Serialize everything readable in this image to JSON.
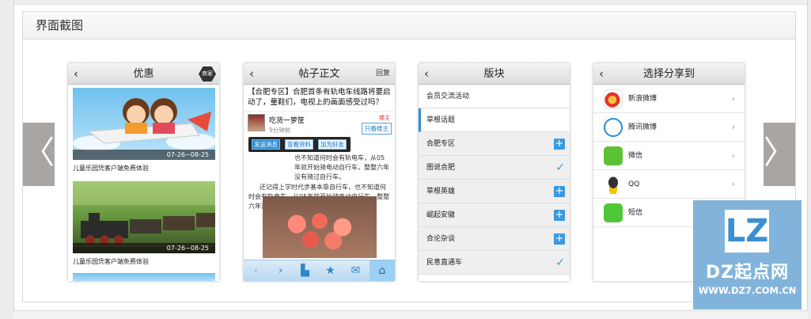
{
  "section": {
    "title": "界面截图"
  },
  "nav": {
    "prev": "〈",
    "next": "〉"
  },
  "phone1": {
    "title": "优惠",
    "badge": "商家",
    "items": [
      {
        "date": "07-26~08-25",
        "caption": "儿童乐园凭客户端免费体验"
      },
      {
        "date": "07-26~08-25",
        "caption": "儿童乐园凭客户端免费体验"
      }
    ]
  },
  "phone2": {
    "title": "帖子正文",
    "reply": "回复",
    "post_title": "【合肥专区】合肥首条有轨电车线路将要启动了，童鞋们，电视上的画面感受过吗？",
    "author": "吃货一箩筐",
    "time": "9分钟前",
    "floor": "楼主",
    "only_host": "只看楼主",
    "body": [
      "也不知道何时会有轨电车，从05年就开始骑电动自行车，整整六年没有骑过自行车。",
      "还记得上学时代步基本靠自行车，也不知道何时会有轨电车，从05年就开始骑电动自行车，整整六年没有骑过自行车。"
    ],
    "popup": {
      "send": "发送消息",
      "profile": "查看资料",
      "friend": "加为好友"
    }
  },
  "phone3": {
    "title": "版块",
    "rows": [
      {
        "label": "会员交流活动"
      },
      {
        "label": "草根话题"
      }
    ],
    "list": [
      {
        "label": "合肥专区",
        "state": "add"
      },
      {
        "label": "图说合肥",
        "state": "added"
      },
      {
        "label": "草根英雄",
        "state": "add"
      },
      {
        "label": "崛起安徽",
        "state": "add"
      },
      {
        "label": "合论杂谈",
        "state": "add"
      },
      {
        "label": "民意直通车",
        "state": "added"
      }
    ]
  },
  "phone4": {
    "title": "选择分享到",
    "items": [
      {
        "label": "新浪微博",
        "icon": "sina-weibo-icon"
      },
      {
        "label": "腾讯微博",
        "icon": "tencent-weibo-icon"
      },
      {
        "label": "微信",
        "icon": "wechat-icon"
      },
      {
        "label": "QQ",
        "icon": "qq-icon"
      },
      {
        "label": "短信",
        "icon": "sms-icon"
      }
    ]
  },
  "watermark": {
    "logo": "LZ",
    "title": "DZ起点网",
    "url": "WWW.DZ7.COM.CN"
  },
  "colors": {
    "accent": "#3a9ae0",
    "nav_arrow": "#a9a5a2",
    "watermark": "#71aad6"
  }
}
